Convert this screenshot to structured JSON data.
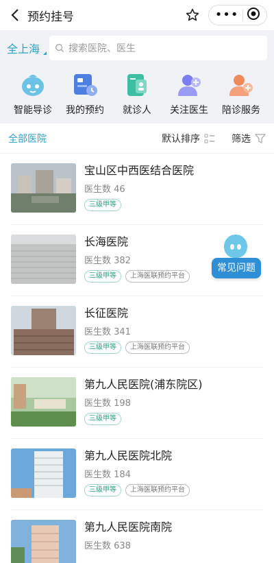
{
  "header": {
    "title": "预约挂号"
  },
  "search": {
    "city": "全上海",
    "placeholder": "搜索医院、医生"
  },
  "quick_actions": [
    {
      "label": "智能导诊",
      "icon": "smart-guide-icon"
    },
    {
      "label": "我的预约",
      "icon": "my-appointments-icon"
    },
    {
      "label": "就诊人",
      "icon": "patient-card-icon"
    },
    {
      "label": "关注医生",
      "icon": "follow-doctor-icon"
    },
    {
      "label": "陪诊服务",
      "icon": "escort-service-icon"
    }
  ],
  "filter": {
    "all": "全部医院",
    "sort": "默认排序",
    "filter": "筛选"
  },
  "hospitals": [
    {
      "name": "宝山区中西医结合医院",
      "doctors": "医生数 46",
      "tags": [
        "三级甲等"
      ]
    },
    {
      "name": "长海医院",
      "doctors": "医生数 382",
      "tags": [
        "三级甲等",
        "上海医联预约平台"
      ]
    },
    {
      "name": "长征医院",
      "doctors": "医生数 341",
      "tags": [
        "三级甲等",
        "上海医联预约平台"
      ]
    },
    {
      "name": "第九人民医院(浦东院区)",
      "doctors": "医生数 198",
      "tags": [
        "三级甲等"
      ]
    },
    {
      "name": "第九人民医院北院",
      "doctors": "医生数 184",
      "tags": [
        "三级甲等",
        "上海医联预约平台"
      ]
    },
    {
      "name": "第九人民医院南院",
      "doctors": "医生数 638",
      "tags": []
    }
  ],
  "faq": {
    "label": "常见问题"
  },
  "colors": {
    "accent": "#2aa3c8",
    "tag_green": "#29a37a"
  }
}
